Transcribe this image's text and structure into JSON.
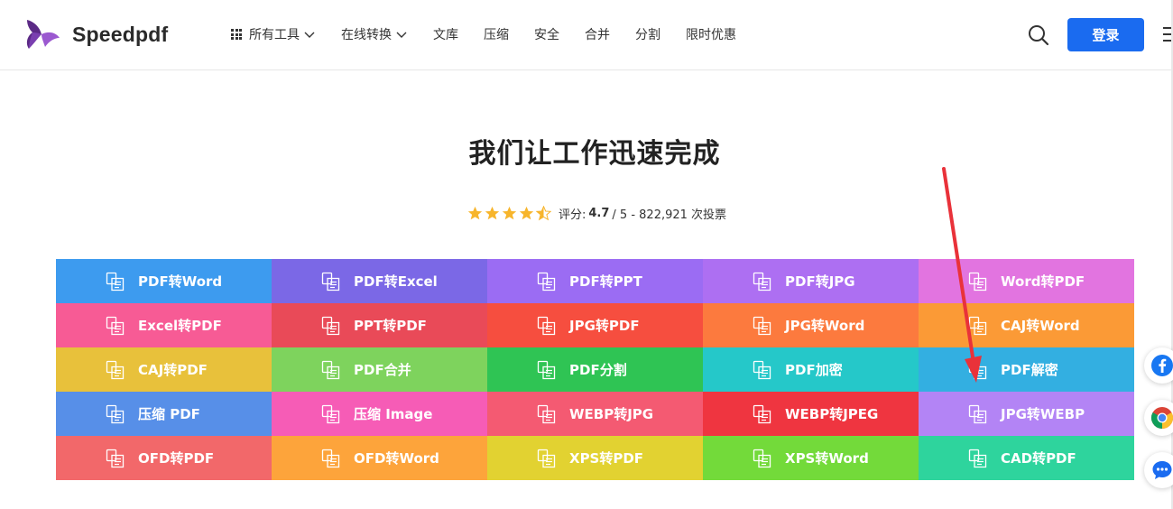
{
  "brand": {
    "name": "Speedpdf"
  },
  "nav": {
    "items": [
      {
        "label": "所有工具",
        "has_grid_icon": true,
        "has_dropdown": true
      },
      {
        "label": "在线转换",
        "has_dropdown": true
      },
      {
        "label": "文库"
      },
      {
        "label": "压缩"
      },
      {
        "label": "安全"
      },
      {
        "label": "合并"
      },
      {
        "label": "分割"
      },
      {
        "label": "限时优惠"
      }
    ],
    "login_label": "登录"
  },
  "hero": {
    "title": "我们让工作迅速完成",
    "rating": {
      "stars": 4.5,
      "prefix": "评分:",
      "score": "4.7",
      "suffix": "/ 5 - 822,921 次投票"
    }
  },
  "tools": [
    {
      "label": "PDF转Word",
      "color": "#3d9bef"
    },
    {
      "label": "PDF转Excel",
      "color": "#7b68e6"
    },
    {
      "label": "PDF转PPT",
      "color": "#9b6cf3"
    },
    {
      "label": "PDF转JPG",
      "color": "#ad6ff2"
    },
    {
      "label": "Word转PDF",
      "color": "#e274e0"
    },
    {
      "label": "Excel转PDF",
      "color": "#f75b95"
    },
    {
      "label": "PPT转PDF",
      "color": "#e94a58"
    },
    {
      "label": "JPG转PDF",
      "color": "#f64e3f"
    },
    {
      "label": "JPG转Word",
      "color": "#fc7a3e"
    },
    {
      "label": "CAJ转Word",
      "color": "#fb9a36"
    },
    {
      "label": "CAJ转PDF",
      "color": "#e8c13b"
    },
    {
      "label": "PDF合并",
      "color": "#7ed35d"
    },
    {
      "label": "PDF分割",
      "color": "#2fc454"
    },
    {
      "label": "PDF加密",
      "color": "#25c8c9"
    },
    {
      "label": "PDF解密",
      "color": "#33afe1"
    },
    {
      "label": "压缩 PDF",
      "color": "#578fe8"
    },
    {
      "label": "压缩 Image",
      "color": "#f65cb6"
    },
    {
      "label": "WEBP转JPG",
      "color": "#f45a72"
    },
    {
      "label": "WEBP转JPEG",
      "color": "#ef3540"
    },
    {
      "label": "JPG转WEBP",
      "color": "#b384f5"
    },
    {
      "label": "OFD转PDF",
      "color": "#f2686a"
    },
    {
      "label": "OFD转Word",
      "color": "#fda43b"
    },
    {
      "label": "XPS转PDF",
      "color": "#e2d231"
    },
    {
      "label": "XPS转Word",
      "color": "#73da3a"
    },
    {
      "label": "CAD转PDF",
      "color": "#2ed49d"
    }
  ],
  "floating": [
    "facebook-icon",
    "chrome-icon",
    "chat-icon"
  ]
}
